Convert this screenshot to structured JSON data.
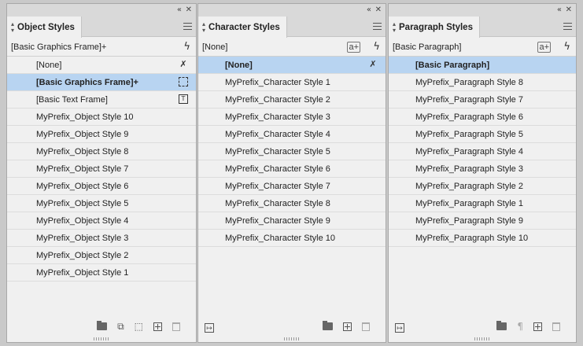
{
  "object_styles": {
    "tab_label": "Object Styles",
    "current": "[Basic Graphics Frame]+",
    "items": [
      {
        "label": "[None]",
        "icon": "clear-override-icon"
      },
      {
        "label": "[Basic Graphics Frame]+",
        "icon": "graphics-frame-icon",
        "selected": true
      },
      {
        "label": "[Basic Text Frame]",
        "icon": "text-frame-icon"
      },
      {
        "label": "MyPrefix_Object Style 10"
      },
      {
        "label": "MyPrefix_Object Style 9"
      },
      {
        "label": "MyPrefix_Object Style 8"
      },
      {
        "label": "MyPrefix_Object Style 7"
      },
      {
        "label": "MyPrefix_Object Style 6"
      },
      {
        "label": "MyPrefix_Object Style 5"
      },
      {
        "label": "MyPrefix_Object Style 4"
      },
      {
        "label": "MyPrefix_Object Style 3"
      },
      {
        "label": "MyPrefix_Object Style 2"
      },
      {
        "label": "MyPrefix_Object Style 1"
      }
    ]
  },
  "character_styles": {
    "tab_label": "Character Styles",
    "current": "[None]",
    "override_label": "a+",
    "items": [
      {
        "label": "[None]",
        "selected": true,
        "icon": "clear-override-icon"
      },
      {
        "label": "MyPrefix_Character Style 1"
      },
      {
        "label": "MyPrefix_Character Style 2"
      },
      {
        "label": "MyPrefix_Character Style 3"
      },
      {
        "label": "MyPrefix_Character Style 4"
      },
      {
        "label": "MyPrefix_Character Style 5"
      },
      {
        "label": "MyPrefix_Character Style 6"
      },
      {
        "label": "MyPrefix_Character Style 7"
      },
      {
        "label": "MyPrefix_Character Style 8"
      },
      {
        "label": "MyPrefix_Character Style 9"
      },
      {
        "label": "MyPrefix_Character Style 10"
      }
    ]
  },
  "paragraph_styles": {
    "tab_label": "Paragraph Styles",
    "current": "[Basic Paragraph]",
    "override_label": "a+",
    "items": [
      {
        "label": "[Basic Paragraph]",
        "selected": true
      },
      {
        "label": "MyPrefix_Paragraph Style 8"
      },
      {
        "label": "MyPrefix_Paragraph Style 7"
      },
      {
        "label": "MyPrefix_Paragraph Style 6"
      },
      {
        "label": "MyPrefix_Paragraph Style 5"
      },
      {
        "label": "MyPrefix_Paragraph Style 4"
      },
      {
        "label": "MyPrefix_Paragraph Style 3"
      },
      {
        "label": "MyPrefix_Paragraph Style 2"
      },
      {
        "label": "MyPrefix_Paragraph Style 1"
      },
      {
        "label": "MyPrefix_Paragraph Style 9"
      },
      {
        "label": "MyPrefix_Paragraph Style 10"
      }
    ]
  },
  "glyphs": {
    "collapse": "«",
    "close": "✕",
    "flash": "ϟ",
    "pin": "✗",
    "text_frame": "T",
    "load_styles": "↦",
    "pilcrow": "¶"
  },
  "colors": {
    "panel_bg": "#f0f0f0",
    "selected_row": "#b8d4f1",
    "header_bg": "#d9d9d9"
  }
}
